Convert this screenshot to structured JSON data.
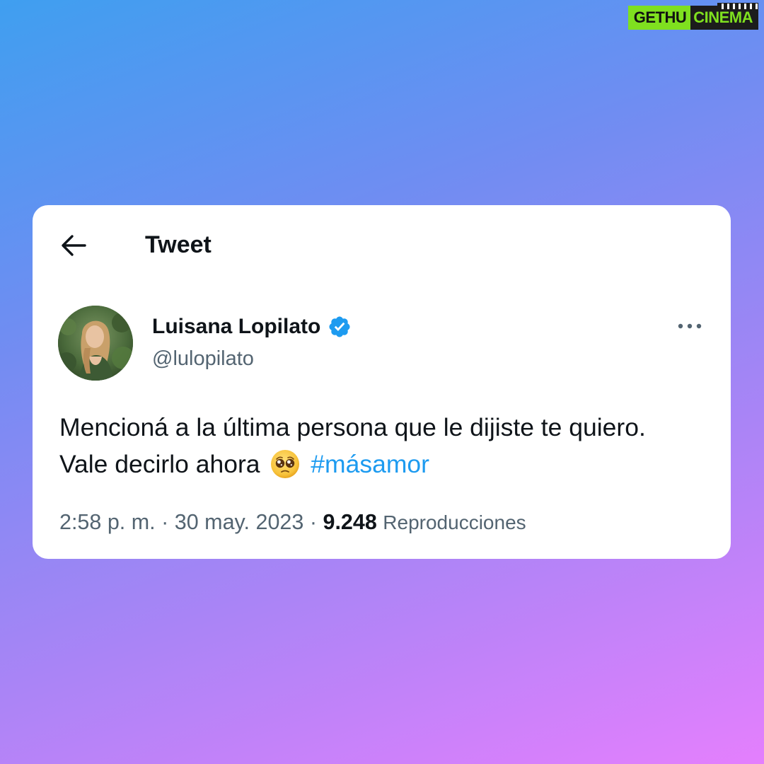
{
  "watermark": {
    "left": "GETHU",
    "right": "CINEMA"
  },
  "header": {
    "back_icon": "arrow-left-icon",
    "title": "Tweet"
  },
  "tweet": {
    "author": {
      "name": "Luisana Lopilato",
      "handle": "@lulopilato",
      "verified_icon": "verified-badge-icon",
      "avatar": "avatar-photo"
    },
    "more_icon": "more-horizontal-icon",
    "text_line1": "Mencioná a la última persona que le dijiste te quiero.",
    "text_line2_prefix": "Vale decirlo ahora",
    "emoji": "pleading-face-emoji",
    "hashtag": "#másamor",
    "time": "2:58 p. m.",
    "separator": "·",
    "date": "30 may. 2023",
    "views_count": "9.248",
    "views_label": "Reproducciones"
  },
  "colors": {
    "background_top": "#3f9ff0",
    "background_bottom": "#e47ffd",
    "card": "#ffffff",
    "text_primary": "#0f1419",
    "text_secondary": "#536471",
    "accent": "#1d9bf0",
    "watermark_green": "#7fe01f"
  }
}
